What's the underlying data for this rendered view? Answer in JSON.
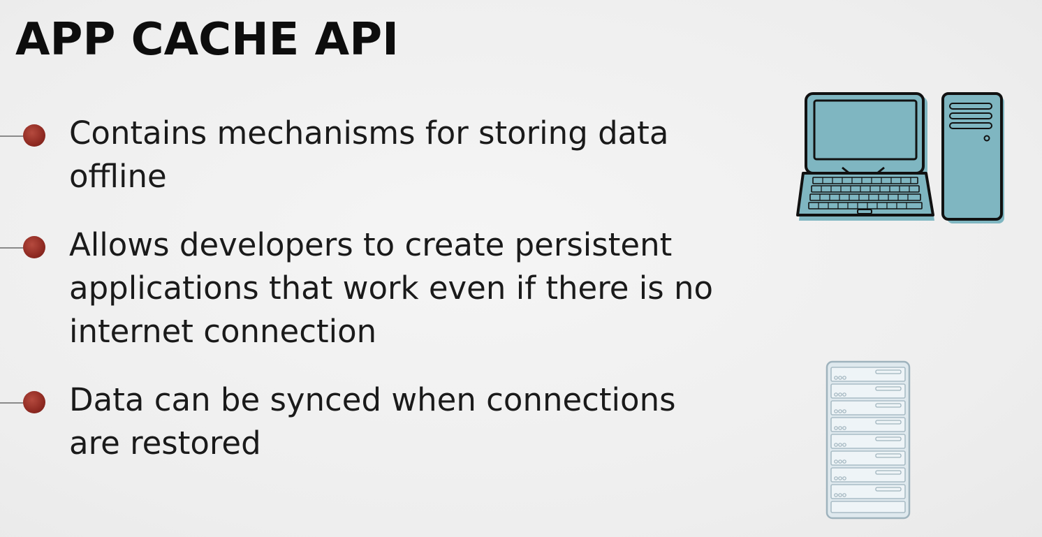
{
  "slide": {
    "title": "APP CACHE API",
    "bullets": [
      {
        "text": "Contains mechanisms for storing data offline"
      },
      {
        "text": "Allows developers to create persistent applications that work even if there is no internet connection"
      },
      {
        "text": "Data can be synced when connections are restored"
      }
    ]
  },
  "illustrations": [
    {
      "icon": "computer-icon",
      "color": "#7fb6c1"
    },
    {
      "icon": "server-rack-icon",
      "color": "#dfe9ee"
    }
  ],
  "colors": {
    "bullet_dot": "#8f2a22",
    "title_text": "#0d0d0d",
    "body_text": "#1a1a1a"
  }
}
